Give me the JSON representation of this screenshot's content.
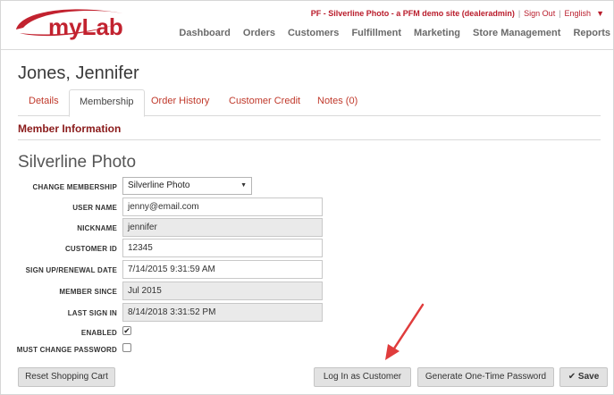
{
  "header": {
    "logo_text": "myLab",
    "site_name": "PF - Silverline Photo - a PFM demo site (dealeradmin)",
    "sign_out": "Sign Out",
    "language": "English",
    "language_caret": "▼",
    "nav": [
      "Dashboard",
      "Orders",
      "Customers",
      "Fulfillment",
      "Marketing",
      "Store Management",
      "Reports"
    ]
  },
  "customer": {
    "name": "Jones, Jennifer"
  },
  "tabs": [
    {
      "label": "Details",
      "active": false
    },
    {
      "label": "Membership",
      "active": true
    },
    {
      "label": "Order History",
      "active": false
    },
    {
      "label": "Customer Credit",
      "active": false
    },
    {
      "label": "Notes (0)",
      "active": false
    }
  ],
  "section": {
    "title": "Member Information",
    "membership_name": "Silverline Photo"
  },
  "form": {
    "change_membership": {
      "label": "CHANGE MEMBERSHIP",
      "value": "Silverline Photo"
    },
    "user_name": {
      "label": "USER NAME",
      "value": "jenny@email.com"
    },
    "nickname": {
      "label": "NICKNAME",
      "value": "jennifer"
    },
    "customer_id": {
      "label": "CUSTOMER ID",
      "value": "12345"
    },
    "signup_renewal": {
      "label": "SIGN UP/RENEWAL DATE",
      "value": "7/14/2015 9:31:59 AM"
    },
    "member_since": {
      "label": "MEMBER SINCE",
      "value": "Jul 2015"
    },
    "last_sign_in": {
      "label": "LAST SIGN IN",
      "value": "8/14/2018 3:31:52 PM"
    },
    "enabled": {
      "label": "ENABLED",
      "checked": true,
      "mark": "✔"
    },
    "must_change_password": {
      "label": "MUST CHANGE PASSWORD",
      "checked": false
    }
  },
  "buttons": {
    "reset_cart": "Reset Shopping Cart",
    "log_in_as_customer": "Log In as Customer",
    "generate_otp": "Generate One-Time Password",
    "save": "Save",
    "save_icon": "✔"
  },
  "colors": {
    "brand_red": "#b91c2b",
    "section_title": "#8a1a1a",
    "annotation_arrow": "#e03c3c"
  },
  "icons": {
    "select_arrow": "▼"
  }
}
